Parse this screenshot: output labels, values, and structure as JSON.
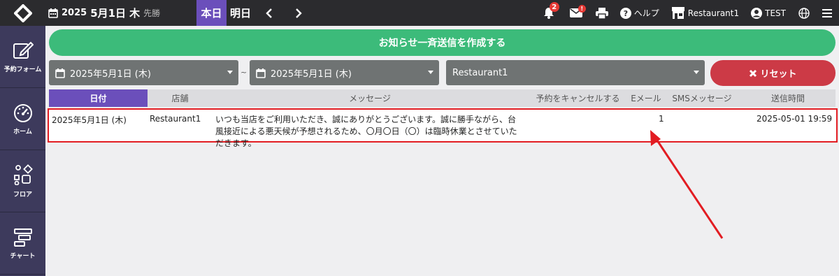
{
  "header": {
    "year": "2025",
    "month_day": "5月1日",
    "weekday": "木",
    "rokuyo": "先勝",
    "today_label": "本日",
    "tomorrow_label": "明日",
    "notifications_count": "2",
    "mail_count": "!",
    "help_label": "ヘルプ",
    "restaurant_label": "Restaurant1",
    "user_label": "TEST"
  },
  "sidebar": {
    "items": [
      {
        "label": "予約フォーム",
        "icon": "edit-icon"
      },
      {
        "label": "ホーム",
        "icon": "dashboard-icon"
      },
      {
        "label": "フロア",
        "icon": "shapes-icon"
      },
      {
        "label": "チャート",
        "icon": "chart-icon"
      }
    ]
  },
  "main": {
    "notify_label": "お知らせ一斉送信を作成する",
    "date_from": "2025年5月1日 (木)",
    "date_sep": "~",
    "date_to": "2025年5月1日 (木)",
    "restaurant_select": "Restaurant1",
    "reset_label": "リセット"
  },
  "table": {
    "columns": [
      "日付",
      "店舗",
      "メッセージ",
      "予約をキャンセルする",
      "Eメール",
      "SMSメッセージ",
      "送信時間"
    ],
    "rows": [
      {
        "date": "2025年5月1日 (木)",
        "store": "Restaurant1",
        "message": "いつも当店をご利用いただき、誠にありがとうございます。誠に勝手ながら、台風接近による悪天候が予想されるため、〇月〇日（〇）は臨時休業とさせていただきます。",
        "cancel": "",
        "email": "1",
        "sms": "",
        "sent_time": "2025-05-01 19:59"
      }
    ]
  },
  "colors": {
    "accent": "#6b4fbb",
    "notify": "#3cbb7a",
    "reset": "#cc3a46",
    "highlight": "#e21c22"
  }
}
